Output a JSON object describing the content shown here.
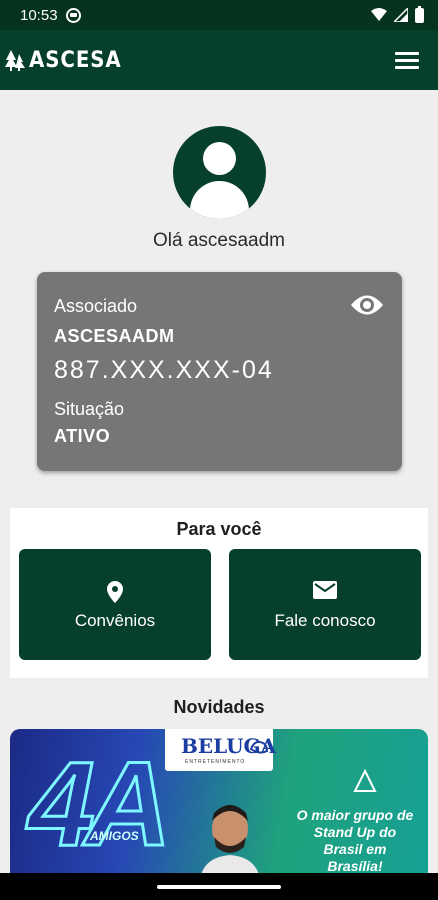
{
  "status_bar": {
    "time": "10:53"
  },
  "app_bar": {
    "title": "ASCESA"
  },
  "greeting": "Olá ascesaadm",
  "member_card": {
    "label_member": "Associado",
    "member_name": "ASCESAADM",
    "cpf": "887.XXX.XXX-04",
    "label_status": "Situação",
    "status": "ATIVO"
  },
  "para_voce": {
    "title": "Para você",
    "buttons": [
      {
        "label": "Convênios",
        "icon": "location-pin-icon"
      },
      {
        "label": "Fale conosco",
        "icon": "envelope-icon"
      }
    ]
  },
  "novidades": {
    "title": "Novidades",
    "banner": {
      "logo_text": "BELUGA",
      "logo_subtext": "ENTRETENIMENTO",
      "headline": "4A",
      "headline_sub": "AMIGOS",
      "promo": "O maior grupo de Stand Up do Brasil em Brasília!"
    }
  },
  "colors": {
    "primary": "#06402a",
    "status_bar": "#06331f",
    "card": "#767676",
    "background": "#eeeeee"
  }
}
